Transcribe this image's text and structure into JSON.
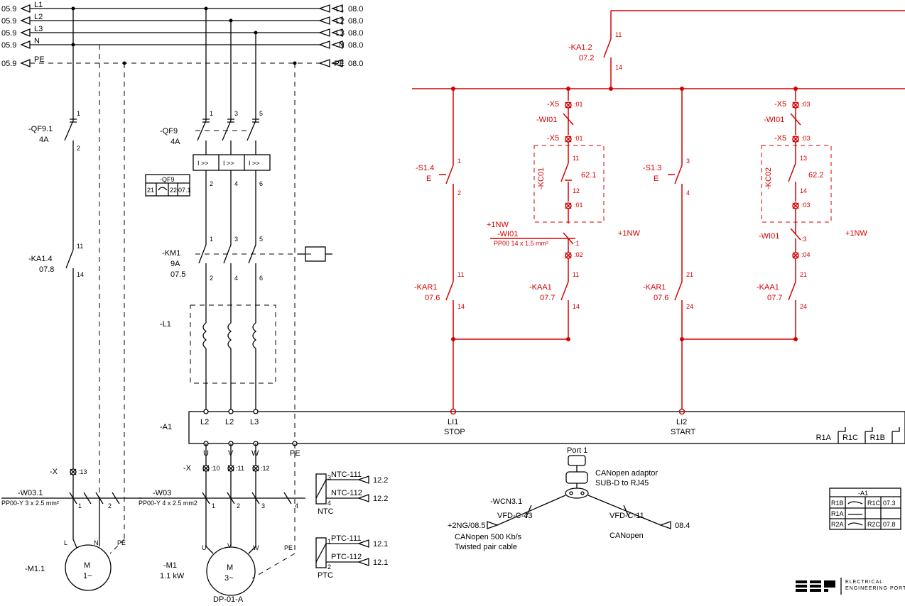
{
  "busRefs": [
    "05.9",
    "05.9",
    "05.9",
    "05.9",
    "05.9"
  ],
  "busNames": [
    "L1",
    "L2",
    "L3",
    "N",
    "PE"
  ],
  "busRefsR": [
    "08.0",
    "08.0",
    "08.0",
    "08.0",
    "08.0"
  ],
  "qf91": {
    "name": "-QF9.1",
    "rat": "4A"
  },
  "qf9": {
    "name": "-QF9",
    "rat": "4A",
    "trip": "I >>"
  },
  "qf9box": {
    "hdr": "-QF9",
    "r1c1": "21",
    "r1c3": "22",
    "r1c4": "07.1"
  },
  "ka14": {
    "name": "-KA1.4",
    "ref": "07.8",
    "t1": "11",
    "t2": "14"
  },
  "km1": {
    "name": "-KM1",
    "rat": "9A",
    "ref": "07.5",
    "top": [
      "1",
      "3",
      "5"
    ],
    "bot": [
      "2",
      "4",
      "6"
    ]
  },
  "l1": "-L1",
  "a1": "-A1",
  "a1topPhases": [
    "L2",
    "L2",
    "L3"
  ],
  "a1bot": [
    "U",
    "V",
    "W",
    "PE"
  ],
  "x": {
    "name": "-X",
    "t": ":13"
  },
  "w031": {
    "name": "-W03.1",
    "spec": "PP00-Y 3 x 2.5 mm²"
  },
  "w03": {
    "name": "-W03",
    "spec": "PP00-Y 4 x 2.5 mm2"
  },
  "xterms": [
    ":10",
    ":11",
    ":12"
  ],
  "m11": {
    "name": "-M1.1",
    "lbl": "M",
    "sub": "1~"
  },
  "m1": {
    "name": "-M1",
    "pow": "1.1 kW",
    "lbl": "M",
    "sub": "3~"
  },
  "dp": "DP-01-A",
  "ntc": {
    "a": "NTC-111",
    "b": "NTC-112",
    "lbl": "NTC",
    "refa": "12.2",
    "refb": "12.2"
  },
  "ptc": {
    "a": "PTC-111",
    "b": "PTC-112",
    "lbl": "PTC",
    "refa": "12.1",
    "refb": "12.1"
  },
  "ka12": {
    "name": "-KA1.2",
    "ref": "07.2",
    "t1": "11",
    "t2": "14"
  },
  "x5": [
    ":01",
    ":03"
  ],
  "wi01": "-WI01",
  "s14": {
    "name": "-S1.4",
    "sub": "E",
    "t1": "1",
    "t2": "2"
  },
  "s13": {
    "name": "-S1.3",
    "sub": "E",
    "t1": "3",
    "t2": "4"
  },
  "kc01": {
    "name": "-KC01",
    "ref": "62.1",
    "t1": "11",
    "t2": "12",
    "x": [
      ":01",
      ":02"
    ]
  },
  "kc02": {
    "name": "-KC02",
    "ref": "62.2",
    "t1": "13",
    "t2": "14",
    "x": [
      ":03",
      ":04"
    ]
  },
  "w101sp": "PP00 14 x 1.5 mm²",
  "nw": "+1NW",
  "kar1": {
    "name": "-KAR1",
    "ref": "07.6",
    "ta": [
      "11",
      "14"
    ],
    "tb": [
      "21",
      "24"
    ]
  },
  "kaa1": {
    "name": "-KAA1",
    "ref": "07.7",
    "ta": [
      "11",
      "14"
    ],
    "tb": [
      "21",
      "24"
    ]
  },
  "li1": {
    "name": "LI1",
    "sub": "STOP"
  },
  "li2": {
    "name": "LI2",
    "sub": "START"
  },
  "relays": [
    "R1A",
    "R1C",
    "R1B"
  ],
  "port": {
    "name": "Port 1",
    "adapt1": "CANopen adaptor",
    "adapt2": "SUB-D to RJ45"
  },
  "wcn": {
    "name": "-WCN3.1",
    "left1": "VFD-C-43",
    "left2": "+2NG/08.5",
    "left3": "CANopen 500 Kb/s",
    "left4": "Twisted pair cable",
    "right1": "VFD-C-11",
    "right2": "CANopen",
    "rightRef": "08.4"
  },
  "a1box": {
    "hdr": "-A1",
    "rows": [
      [
        "R1B",
        "",
        "R1C",
        "07.3"
      ],
      [
        "R1A",
        "",
        "",
        " "
      ],
      [
        "R2A",
        "",
        "R2C",
        "07.8"
      ]
    ]
  },
  "logo": {
    "a": "EEP",
    "b": "ELECTRICAL",
    "c": "ENGINEERING PORTAL"
  }
}
